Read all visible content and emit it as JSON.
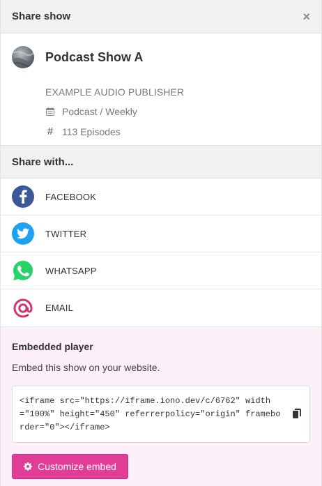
{
  "header": {
    "title": "Share show",
    "close_glyph": "×"
  },
  "show": {
    "title": "Podcast Show A",
    "publisher": "EXAMPLE AUDIO PUBLISHER",
    "category": "Podcast / Weekly",
    "episodes": "113 Episodes",
    "episodes_glyph": "#"
  },
  "share": {
    "heading": "Share with...",
    "items": [
      {
        "label": "FACEBOOK",
        "icon": "facebook-icon",
        "color": "#3b5998"
      },
      {
        "label": "TWITTER",
        "icon": "twitter-icon",
        "color": "#1da1f2"
      },
      {
        "label": "WHATSAPP",
        "icon": "whatsapp-icon",
        "color": "#25d366"
      },
      {
        "label": "EMAIL",
        "icon": "at-sign-icon",
        "color": "#d6336c"
      }
    ]
  },
  "embed": {
    "title": "Embedded player",
    "description": "Embed this show on your website.",
    "code": "<iframe src=\"https://iframe.iono.dev/c/6762\" width=\"100%\" height=\"450\" referrerpolicy=\"origin\" frameborder=\"0\"></iframe>",
    "button_label": "Customize embed",
    "button_color": "#e23d96"
  }
}
